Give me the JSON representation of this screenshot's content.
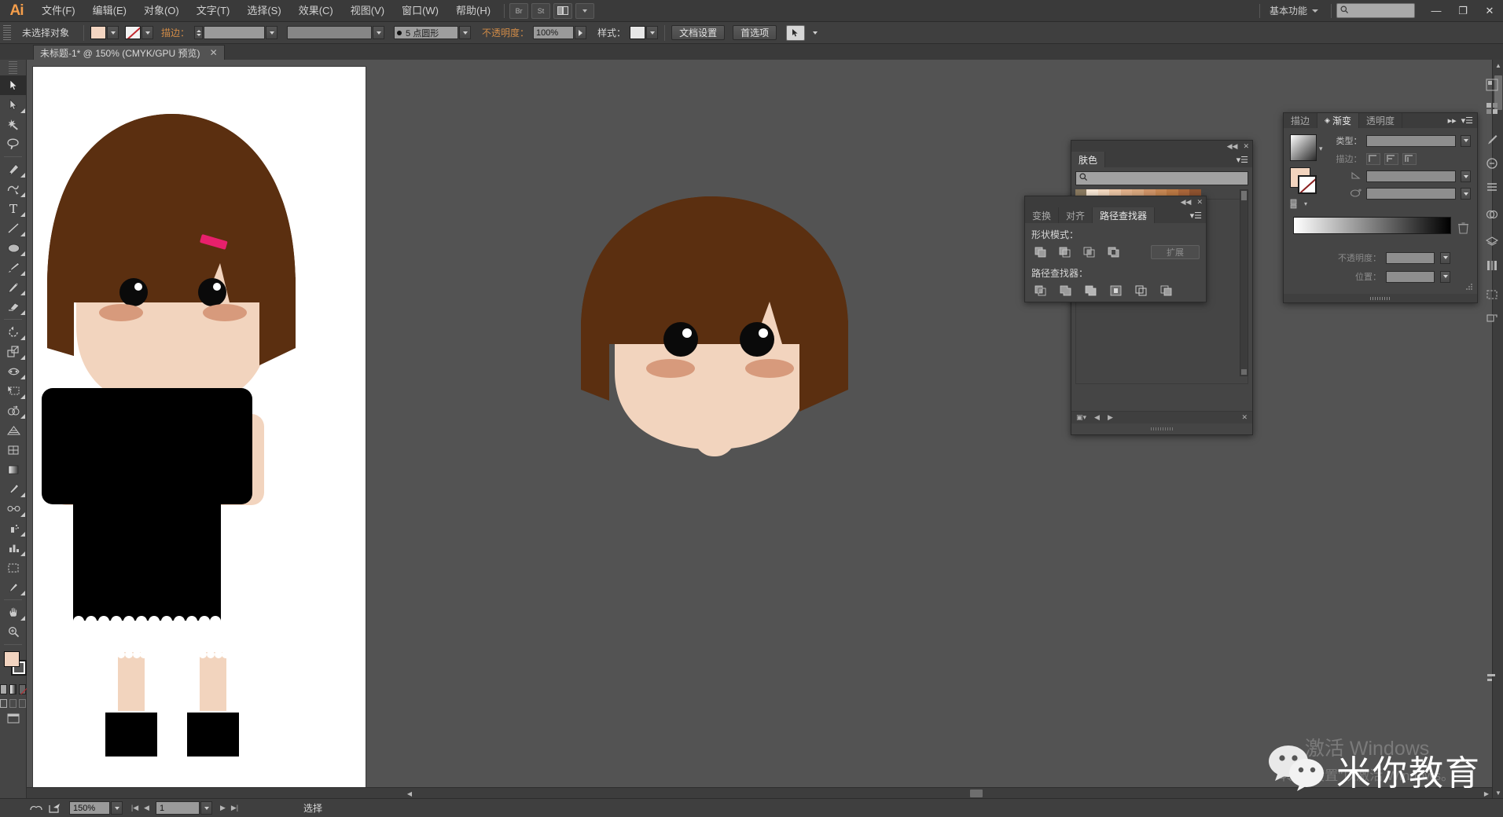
{
  "app": {
    "name": "Ai",
    "logo_text": "Ai"
  },
  "menubar": {
    "items": [
      {
        "label": "文件(F)",
        "name": "menu-file"
      },
      {
        "label": "编辑(E)",
        "name": "menu-edit"
      },
      {
        "label": "对象(O)",
        "name": "menu-object"
      },
      {
        "label": "文字(T)",
        "name": "menu-type"
      },
      {
        "label": "选择(S)",
        "name": "menu-select"
      },
      {
        "label": "效果(C)",
        "name": "menu-effect"
      },
      {
        "label": "视图(V)",
        "name": "menu-view"
      },
      {
        "label": "窗口(W)",
        "name": "menu-window"
      },
      {
        "label": "帮助(H)",
        "name": "menu-help"
      }
    ],
    "bridge_label": "Br",
    "stock_label": "St",
    "workspace": "基本功能",
    "search_placeholder": "",
    "window_minimize": "—",
    "window_restore": "❐",
    "window_close": "✕"
  },
  "controlbar": {
    "selection_status": "未选择对象",
    "fill_color": "#f3d5c1",
    "stroke_label": "描边：",
    "stroke_weight_value": "",
    "stroke_profile_value": "",
    "brush_label": "5 点圆形",
    "opacity_label": "不透明度：",
    "opacity_value": "100%",
    "style_label": "样式：",
    "document_setup": "文档设置",
    "preferences": "首选项",
    "select_similar_label": "选择相似对象"
  },
  "tabbar": {
    "document_tab": "未标题-1* @ 150% (CMYK/GPU 预览)",
    "close": "✕"
  },
  "toolbar": {
    "tools": [
      {
        "name": "selection-tool",
        "label": "选择工具",
        "active": true
      },
      {
        "name": "direct-selection-tool",
        "label": "直接选择工具",
        "active": false
      },
      {
        "name": "magic-wand-tool",
        "label": "魔棒工具",
        "active": false
      },
      {
        "name": "lasso-tool",
        "label": "套索工具",
        "active": false
      },
      {
        "name": "pen-tool",
        "label": "钢笔工具",
        "active": false
      },
      {
        "name": "curvature-tool",
        "label": "曲率工具",
        "active": false
      },
      {
        "name": "type-tool",
        "label": "文字工具",
        "active": false
      },
      {
        "name": "line-segment-tool",
        "label": "直线段工具",
        "active": false
      },
      {
        "name": "ellipse-tool",
        "label": "椭圆工具",
        "active": false
      },
      {
        "name": "paintbrush-tool",
        "label": "画笔工具",
        "active": false
      },
      {
        "name": "pencil-tool",
        "label": "铅笔工具",
        "active": false
      },
      {
        "name": "eraser-tool",
        "label": "橡皮擦工具",
        "active": false
      },
      {
        "name": "rotate-tool",
        "label": "旋转工具",
        "active": false
      },
      {
        "name": "scale-tool",
        "label": "比例缩放工具",
        "active": false
      },
      {
        "name": "width-tool",
        "label": "宽度工具",
        "active": false
      },
      {
        "name": "free-transform-tool",
        "label": "自由变换工具",
        "active": false
      },
      {
        "name": "shape-builder-tool",
        "label": "形状生成器工具",
        "active": false
      },
      {
        "name": "perspective-grid-tool",
        "label": "透视网格工具",
        "active": false
      },
      {
        "name": "mesh-tool",
        "label": "网格工具",
        "active": false
      },
      {
        "name": "gradient-tool",
        "label": "渐变工具",
        "active": false
      },
      {
        "name": "eyedropper-tool",
        "label": "吸管工具",
        "active": false
      },
      {
        "name": "blend-tool",
        "label": "混合工具",
        "active": false
      },
      {
        "name": "symbol-sprayer-tool",
        "label": "符号喷枪工具",
        "active": false
      },
      {
        "name": "column-graph-tool",
        "label": "柱形图工具",
        "active": false
      },
      {
        "name": "artboard-tool",
        "label": "画板工具",
        "active": false
      },
      {
        "name": "slice-tool",
        "label": "切片工具",
        "active": false
      },
      {
        "name": "hand-tool",
        "label": "抓手工具",
        "active": false
      },
      {
        "name": "zoom-tool",
        "label": "缩放工具",
        "active": false
      }
    ],
    "fill_color": "#f3d5c1",
    "stroke_color": "#ffffff"
  },
  "panels": {
    "skin": {
      "title": "肤色",
      "search_placeholder": "",
      "swatch_colors": [
        "#f7e6d4",
        "#f3d9c0",
        "#eac4a4",
        "#e0b08a",
        "#d9a87e",
        "#cf9468",
        "#c68753",
        "#bb7944",
        "#a9663a",
        "#8f5330"
      ],
      "folder_icon": "folder-icon"
    },
    "pathfinder": {
      "tabs": [
        {
          "label": "变换",
          "name": "panel-tab-transform",
          "active": false
        },
        {
          "label": "对齐",
          "name": "panel-tab-align",
          "active": false
        },
        {
          "label": "路径查找器",
          "name": "panel-tab-pathfinder",
          "active": true
        }
      ],
      "shape_modes_label": "形状模式：",
      "shape_modes": [
        {
          "name": "unite-button",
          "label": "联集"
        },
        {
          "name": "minus-front-button",
          "label": "减去顶层"
        },
        {
          "name": "intersect-button",
          "label": "交集"
        },
        {
          "name": "exclude-button",
          "label": "差集"
        }
      ],
      "expand_label": "扩展",
      "pathfinders_label": "路径查找器：",
      "pathfinders": [
        {
          "name": "divide-button",
          "label": "分割"
        },
        {
          "name": "trim-button",
          "label": "修边"
        },
        {
          "name": "merge-button",
          "label": "合并"
        },
        {
          "name": "crop-button",
          "label": "裁剪"
        },
        {
          "name": "outline-button",
          "label": "轮廓"
        },
        {
          "name": "minus-back-button",
          "label": "减去后方对象"
        }
      ]
    },
    "gradient": {
      "tabs": [
        {
          "label": "描边",
          "name": "panel-tab-stroke",
          "active": false
        },
        {
          "label": "渐变",
          "name": "panel-tab-gradient",
          "active": true
        },
        {
          "label": "透明度",
          "name": "panel-tab-transparency",
          "active": false
        }
      ],
      "type_label": "类型：",
      "type_value": "",
      "stroke_label": "描边：",
      "angle_label": "",
      "angle_value": "",
      "aspect_label": "",
      "aspect_value": "",
      "opacity_label": "不透明度：",
      "opacity_value": "",
      "location_label": "位置：",
      "location_value": "",
      "gradient_from": "#ffffff",
      "gradient_to": "#000000",
      "delete_icon": "trash-icon"
    }
  },
  "statusbar": {
    "zoom_value": "150%",
    "page_value": "1",
    "status_text": "选择",
    "nav_first": "|◀",
    "nav_prev": "◀",
    "nav_next": "▶",
    "nav_last": "▶|"
  },
  "artwork": {
    "skin": "#f2d4be",
    "hair": "#5b2f10",
    "cheek": "#d79a7c",
    "eye": "#0a0a0a",
    "eye_highlight": "#ffffff",
    "clip": "#e8206c",
    "shirt": "#000000",
    "description_left": "卡通女孩全身插图",
    "description_right": "卡通女孩头部插图"
  },
  "watermark": {
    "brand": "米你教育",
    "icon": "wechat-icon",
    "windows_line1": "激活 Windows",
    "windows_line2": "转到\"设置\"以激活 Windows。"
  }
}
